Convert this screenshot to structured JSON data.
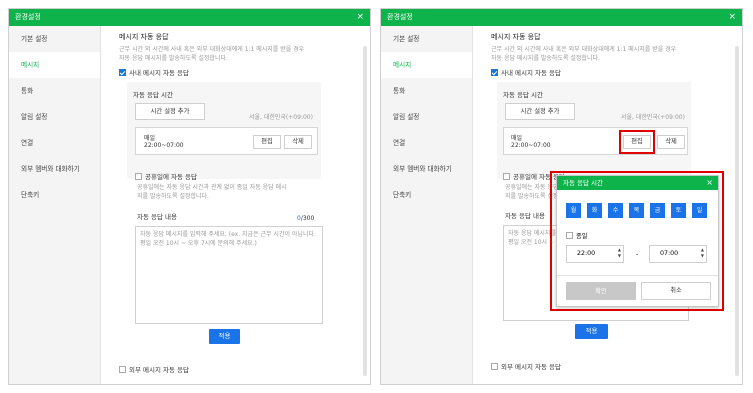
{
  "window_title": "환경설정",
  "close_glyph": "×",
  "sidebar": {
    "items": [
      {
        "label": "기본 설정"
      },
      {
        "label": "메시지"
      },
      {
        "label": "통화"
      },
      {
        "label": "알림 설정"
      },
      {
        "label": "연결"
      },
      {
        "label": "외부 멤버와 대화하기"
      },
      {
        "label": "단축키"
      }
    ]
  },
  "auto_reply": {
    "section_title": "메시지 자동 응답",
    "description_line1": "근무 시간 외 시간에 사내 혹은 외부 대화상대에게 1:1 메시지를 받을 경우",
    "description_line2": "자동 응답 메시지를 발송하도록 설정합니다.",
    "internal_checkbox_label": "사내 메시지 자동 응답",
    "schedule_title": "자동 응답 시간",
    "add_time_button": "시간 설정 추가",
    "timezone": "서울, 대한민국(+09:00)",
    "schedule_item": {
      "days": "매일",
      "time": "22:00~07:00"
    },
    "edit_button": "편집",
    "delete_button": "삭제",
    "holiday_checkbox_label": "공휴일에 자동 응답",
    "holiday_desc_line1": "공휴일에는 자동 응답 시간과 관계 없이 종일 자동 응답 메시",
    "holiday_desc_line2": "지를 발송하도록 설정합니다.",
    "reply_content_title": "자동 응답 내용",
    "char_count_current": "0",
    "char_count_max": "/300",
    "textarea_placeholder": "자동 응답 메시지를 입력해 주세요. (ex. 지금은 근무 시간이 아닙니다. 평일 오전 10시 ~ 오후 7시에 문의해 주세요.)",
    "apply_button": "적용",
    "external_checkbox_label": "외부 메시지 자동 응답"
  },
  "dialog": {
    "title": "자동 응답 시간",
    "days": [
      "월",
      "화",
      "수",
      "목",
      "금",
      "토",
      "일"
    ],
    "all_day_label": "종일",
    "start_time": "22:00",
    "end_time": "07:00",
    "separator": "-",
    "confirm_button": "확인",
    "cancel_button": "취소"
  },
  "colors": {
    "brand_green": "#0fb34b",
    "accent_blue": "#1a73e8",
    "highlight_red": "#e00000"
  }
}
